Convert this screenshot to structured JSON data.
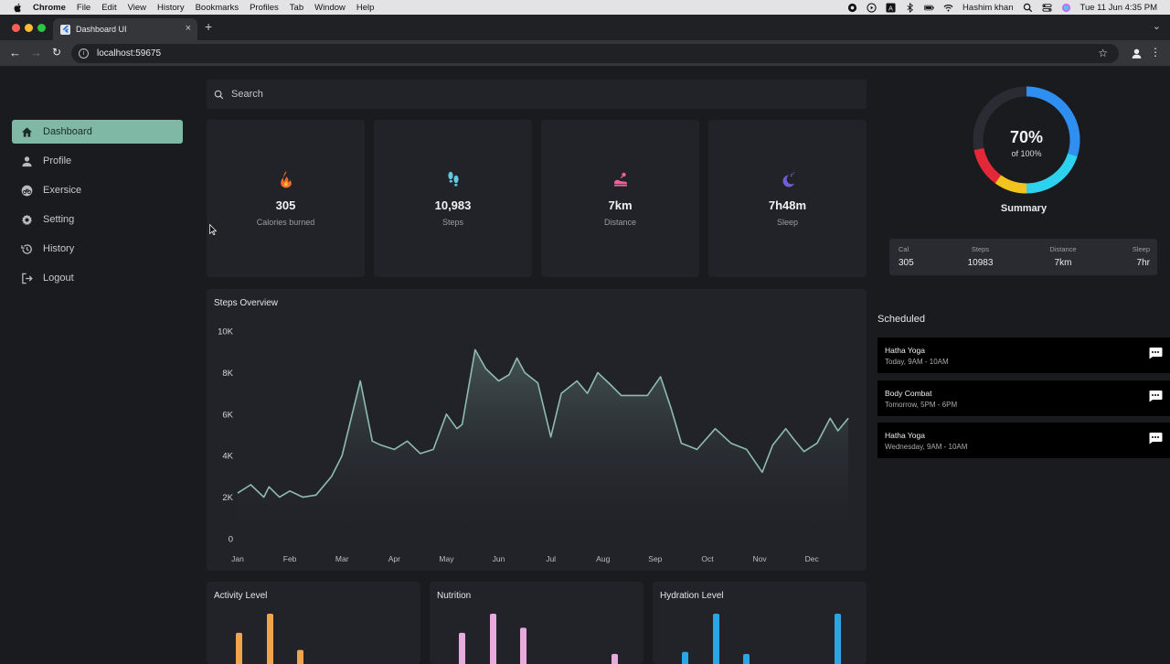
{
  "os_menu": {
    "app": "Chrome",
    "items": [
      "File",
      "Edit",
      "View",
      "History",
      "Bookmarks",
      "Profiles",
      "Tab",
      "Window",
      "Help"
    ],
    "user": "Hashim khan",
    "datetime": "Tue 11 Jun  4:35 PM"
  },
  "browser": {
    "tab_title": "Dashboard UI",
    "url": "localhost:59675"
  },
  "sidebar": {
    "items": [
      {
        "label": "Dashboard",
        "icon": "home-icon",
        "active": true
      },
      {
        "label": "Profile",
        "icon": "person-icon"
      },
      {
        "label": "Exersice",
        "icon": "bicycle-icon"
      },
      {
        "label": "Setting",
        "icon": "gear-icon"
      },
      {
        "label": "History",
        "icon": "history-icon"
      },
      {
        "label": "Logout",
        "icon": "logout-icon"
      }
    ]
  },
  "search": {
    "placeholder": "Search"
  },
  "stats": [
    {
      "value": "305",
      "label": "Calories burned",
      "icon": "fire-icon",
      "color": "#f26b2c"
    },
    {
      "value": "10,983",
      "label": "Steps",
      "icon": "footprints-icon",
      "color": "#5fc9e0"
    },
    {
      "value": "7km",
      "label": "Distance",
      "icon": "running-shoe-icon",
      "color": "#f0609a"
    },
    {
      "value": "7h48m",
      "label": "Sleep",
      "icon": "moon-sleep-icon",
      "color": "#6d5fd6"
    }
  ],
  "steps_overview": {
    "title": "Steps Overview"
  },
  "chart_data": [
    {
      "type": "area",
      "title": "Steps Overview",
      "x_tick_labels": [
        "Jan",
        "Feb",
        "Mar",
        "Apr",
        "May",
        "Jun",
        "Jul",
        "Aug",
        "Sep",
        "Oct",
        "Nov",
        "Dec"
      ],
      "y_tick_labels": [
        "0",
        "2K",
        "4K",
        "6K",
        "8K",
        "10K"
      ],
      "ylim": [
        0,
        10000
      ],
      "xlim": [
        0,
        11.75
      ],
      "grid": false,
      "line_color": "#8fbcb0",
      "x": [
        0.0,
        0.25,
        0.5,
        0.6,
        0.8,
        1.0,
        1.25,
        1.5,
        1.8,
        2.0,
        2.35,
        2.58,
        2.75,
        3.0,
        3.25,
        3.5,
        3.75,
        4.0,
        4.2,
        4.3,
        4.55,
        4.75,
        5.0,
        5.2,
        5.35,
        5.5,
        5.75,
        6.0,
        6.2,
        6.5,
        6.7,
        6.9,
        7.15,
        7.35,
        7.6,
        7.85,
        8.1,
        8.3,
        8.5,
        8.8,
        9.15,
        9.45,
        9.75,
        10.05,
        10.25,
        10.5,
        10.65,
        10.85,
        11.1,
        11.35,
        11.5,
        11.7
      ],
      "y": [
        2200,
        2600,
        2000,
        2500,
        2000,
        2300,
        2000,
        2100,
        3000,
        4000,
        7600,
        4700,
        4500,
        4300,
        4700,
        4100,
        4300,
        6000,
        5300,
        5500,
        9100,
        8200,
        7600,
        7900,
        8700,
        8000,
        7500,
        4900,
        7000,
        7600,
        7000,
        8000,
        7400,
        6900,
        6900,
        6900,
        7800,
        6300,
        4600,
        4300,
        5300,
        4600,
        4300,
        3200,
        4500,
        5300,
        4800,
        4200,
        4600,
        5800,
        5200,
        5800
      ]
    },
    {
      "type": "bar",
      "title": "Activity Level",
      "values": [
        0.62,
        1.0,
        0.28
      ],
      "color": "#f0a44c"
    },
    {
      "type": "bar",
      "title": "Nutrition",
      "values": [
        0.62,
        1.0,
        0.72,
        0.2
      ],
      "color": "#e8a9dc"
    },
    {
      "type": "bar",
      "title": "Hydration Level",
      "values": [
        0.24,
        1.0,
        0.2,
        1.0
      ],
      "color": "#2aa6e6"
    },
    {
      "type": "pie",
      "title": "Summary",
      "center_value": "70%",
      "center_sub": "of 100%",
      "segments": [
        {
          "color": "#2f8ff0",
          "value": 30
        },
        {
          "color": "#2dd2ee",
          "value": 20
        },
        {
          "color": "#f4c21c",
          "value": 10
        },
        {
          "color": "#e3283a",
          "value": 12
        },
        {
          "color": "#2b2c33",
          "value": 28
        }
      ]
    }
  ],
  "small_cards": [
    {
      "title": "Activity Level"
    },
    {
      "title": "Nutrition"
    },
    {
      "title": "Hydration Level"
    }
  ],
  "summary": {
    "center_value": "70%",
    "center_sub": "of 100%",
    "title": "Summary",
    "cols": [
      {
        "h": "Cal",
        "v": "305"
      },
      {
        "h": "Steps",
        "v": "10983"
      },
      {
        "h": "Distance",
        "v": "7km"
      },
      {
        "h": "Sleep",
        "v": "7hr"
      }
    ]
  },
  "scheduled": {
    "title": "Scheduled",
    "items": [
      {
        "name": "Hatha Yoga",
        "time": "Today, 9AM - 10AM"
      },
      {
        "name": "Body Combat",
        "time": "Tomorrow, 5PM - 6PM"
      },
      {
        "name": "Hatha Yoga",
        "time": "Wednesday, 9AM - 10AM"
      }
    ]
  },
  "colors": {
    "accent": "#7fb9a6",
    "background": "#1a1b1f",
    "card": "#222329"
  }
}
